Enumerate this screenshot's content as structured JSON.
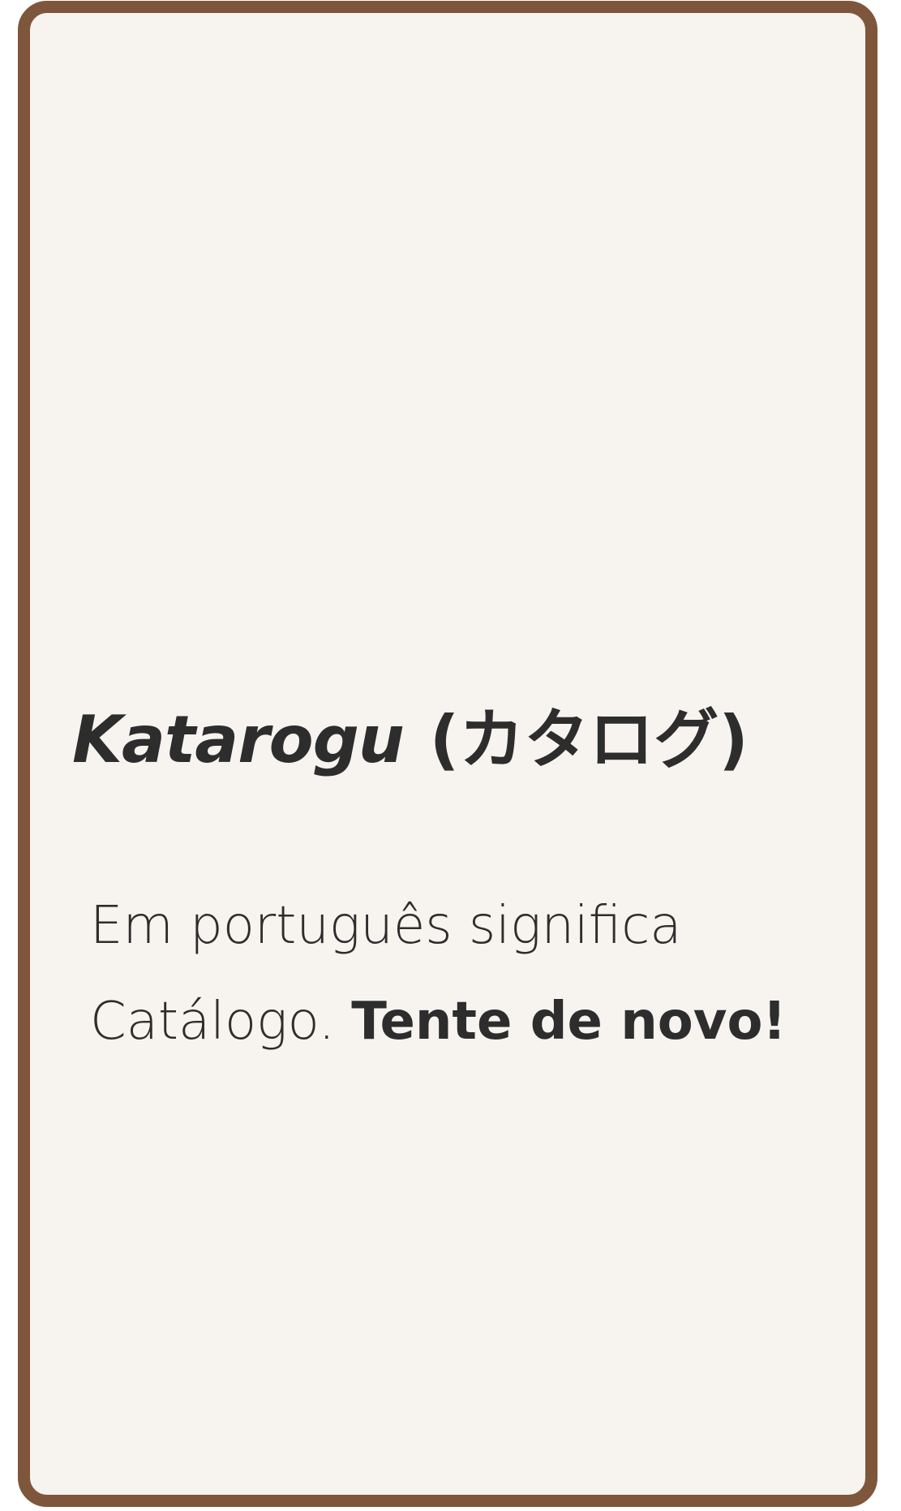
{
  "card": {
    "title_word": "Katarogu",
    "title_japanese": "(カタログ)",
    "description_plain": "Em português significa Catálogo.",
    "description_emphasis": "Tente de novo!"
  },
  "colors": {
    "border": "#7e563b",
    "background": "#f7f3ef",
    "text": "#2d2d2d"
  }
}
